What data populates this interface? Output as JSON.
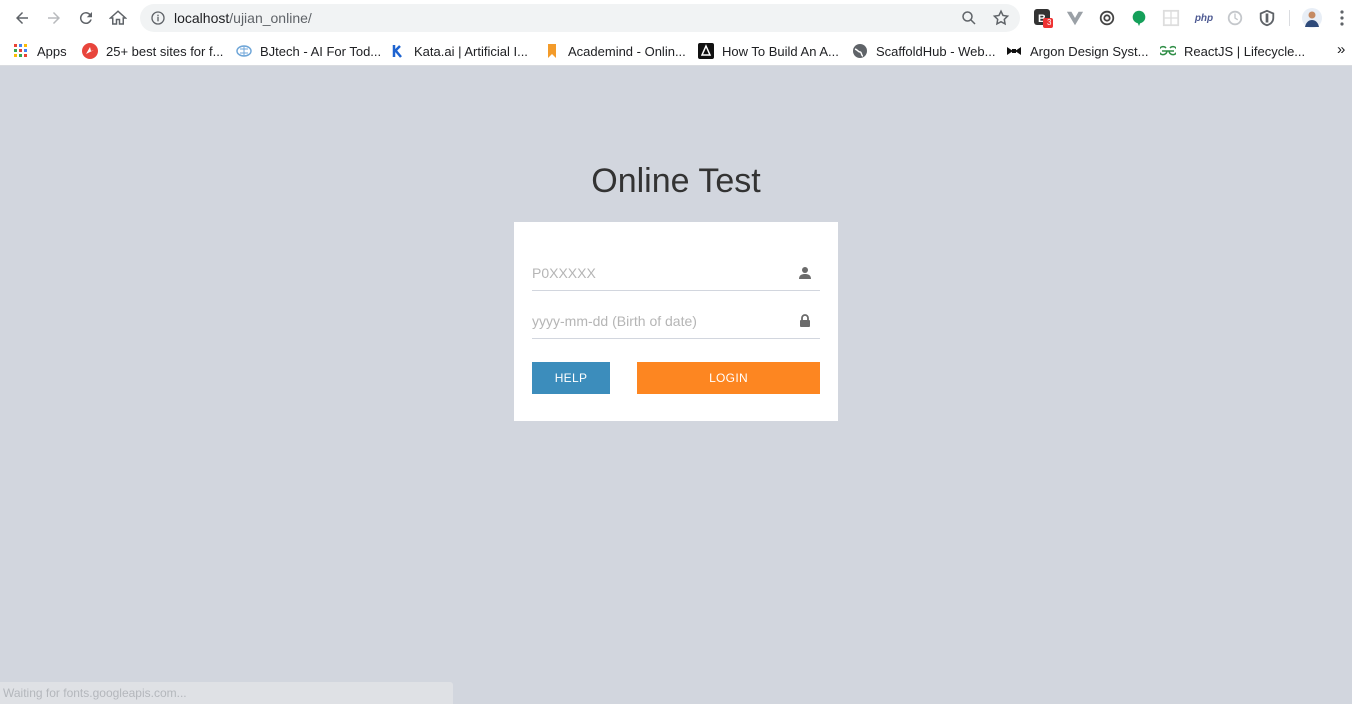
{
  "browser": {
    "url_host": "localhost",
    "url_path": "/ujian_online/",
    "extension_badge": "3",
    "php_label": "php"
  },
  "bookmarks": [
    {
      "label": "Apps"
    },
    {
      "label": "25+ best sites for f..."
    },
    {
      "label": "BJtech - AI For Tod..."
    },
    {
      "label": "Kata.ai | Artificial I..."
    },
    {
      "label": "Academind - Onlin..."
    },
    {
      "label": "How To Build An A..."
    },
    {
      "label": "ScaffoldHub - Web..."
    },
    {
      "label": "Argon Design Syst..."
    },
    {
      "label": "ReactJS | Lifecycle..."
    }
  ],
  "more_bookmarks": "»",
  "page": {
    "title": "Online Test",
    "username_placeholder": "P0XXXXX",
    "password_placeholder": "yyyy-mm-dd (Birth of date)",
    "help_label": "HELP",
    "login_label": "LOGIN"
  },
  "status_text": "Waiting for fonts.googleapis.com...",
  "colors": {
    "page_bg": "#d2d6de",
    "help_button": "#3c8dbc",
    "login_button": "#fd8621"
  }
}
